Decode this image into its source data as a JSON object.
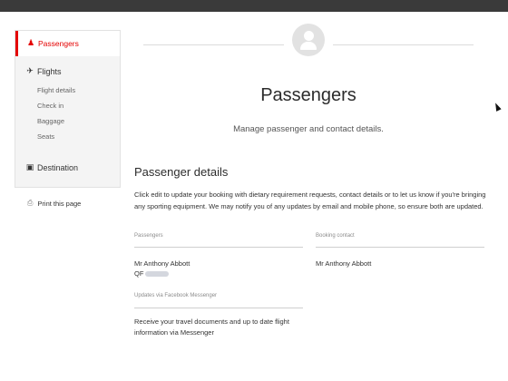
{
  "sidebar": {
    "active": {
      "label": "Passengers",
      "icon": "person-icon"
    },
    "flights": {
      "label": "Flights",
      "icon": "airplane-icon",
      "items": [
        "Flight details",
        "Check in",
        "Baggage",
        "Seats"
      ]
    },
    "destination": {
      "label": "Destination",
      "icon": "camera-icon"
    },
    "print": {
      "label": "Print this page",
      "icon": "printer-icon"
    }
  },
  "header": {
    "title": "Passengers",
    "subtitle": "Manage passenger and contact details."
  },
  "details": {
    "title": "Passenger details",
    "description": "Click edit to update your booking with dietary requirement requests, contact details or to let us know if you're bringing any sporting equipment. We may notify you of any updates by email and mobile phone, so ensure both are updated.",
    "passengers_label": "Passengers",
    "passenger_name": "Mr Anthony Abbott",
    "frequent_flyer_prefix": "QF",
    "booking_contact_label": "Booking contact",
    "booking_contact_name": "Mr Anthony Abbott",
    "messenger_label": "Updates via Facebook Messenger",
    "messenger_text": "Receive your travel documents and up to date flight information via Messenger"
  },
  "colors": {
    "accent": "#e40000",
    "sidebar_bg": "#f4f4f4",
    "topbar": "#3a3a3a"
  }
}
